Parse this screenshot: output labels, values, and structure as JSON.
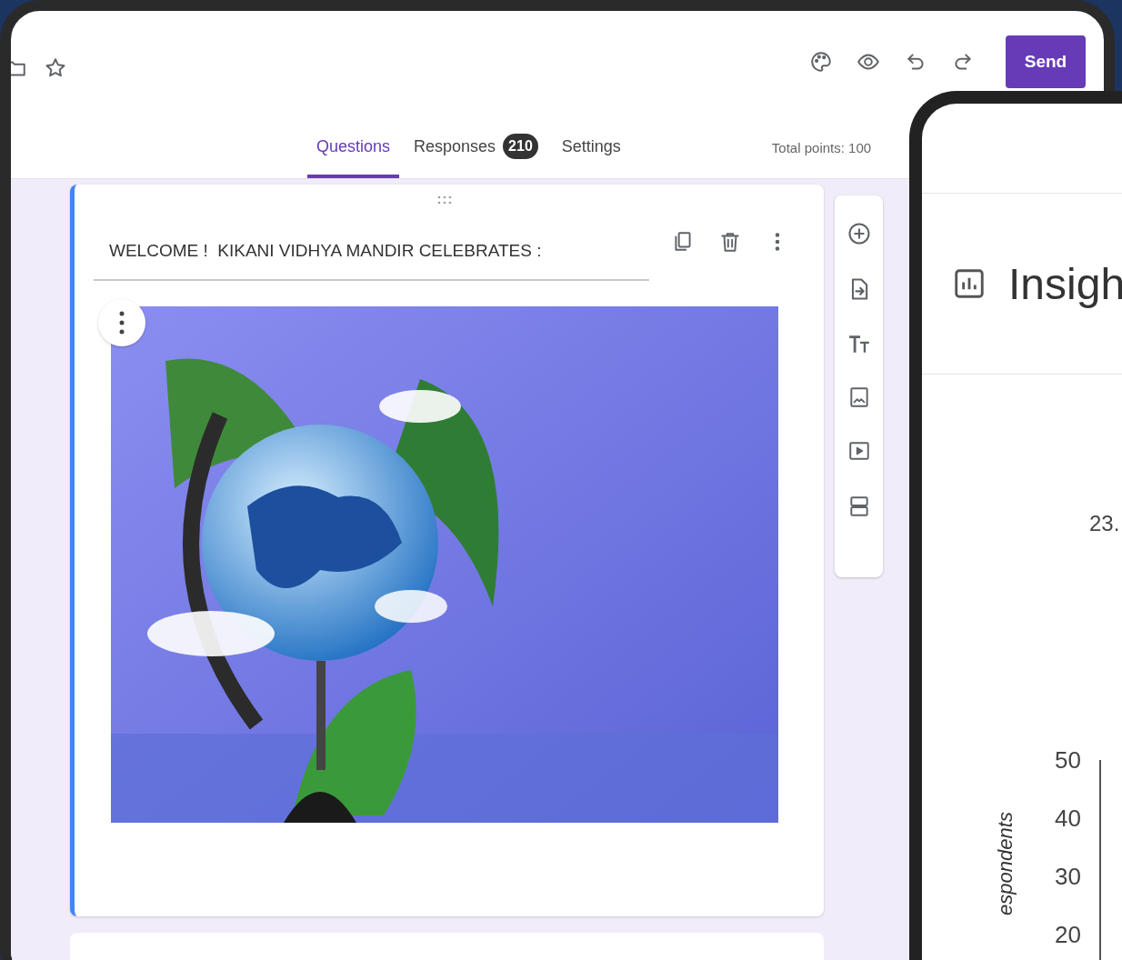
{
  "header": {
    "send_button": "Send"
  },
  "tabs": [
    {
      "label": "Questions",
      "selected": true
    },
    {
      "label": "Responses",
      "selected": false,
      "badge": "210"
    },
    {
      "label": "Settings",
      "selected": false
    }
  ],
  "total_points": "Total points: 100",
  "card": {
    "title": "WELCOME !  KIKANI VIDHYA MANDIR CELEBRATES :"
  },
  "insights": {
    "title": "Insigh",
    "value": "23.",
    "y_axis_label": "espondents",
    "y_ticks": [
      "50",
      "40",
      "30",
      "20"
    ]
  }
}
